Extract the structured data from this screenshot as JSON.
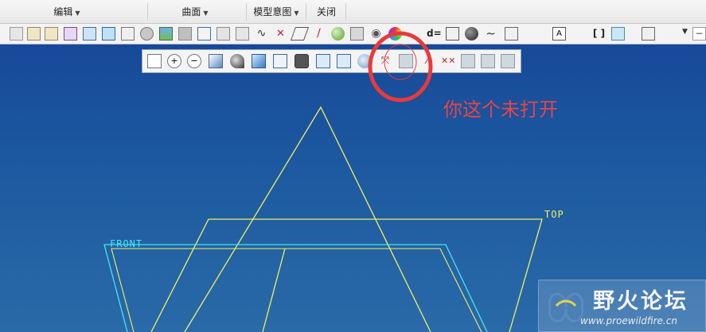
{
  "menubar": {
    "items": [
      {
        "label": "编辑"
      },
      {
        "label": "曲面"
      },
      {
        "label": "模型意图"
      },
      {
        "label": "关闭"
      }
    ]
  },
  "toolbar": {
    "icons": [
      "copy-icon",
      "paste-icon",
      "paste-special-icon",
      "frame-icon",
      "book-icon",
      "cube-flip-icon",
      "layer-tree-icon",
      "analysis-icon",
      "image-icon",
      "shade-icon",
      "surface-icon",
      "sketch-icon",
      "repaint-icon",
      "curve-icon",
      "datum-point-icon",
      "plane-icon",
      "axis-icon",
      "sphere-icon",
      "lock-icon",
      "hide-icon",
      "appearance-icon",
      "dimension-icon",
      "tolerance-icon",
      "sphere-dark-icon",
      "wave-icon",
      "box-icon",
      "annotation-icon",
      "bracket-icon",
      "bookmark-icon",
      "transform-icon",
      "more-icon"
    ]
  },
  "view_toolbar": {
    "icons": [
      "refit-icon",
      "zoom-in-icon",
      "zoom-out-icon",
      "repaint-icon",
      "display-style-icon",
      "saved-views-icon",
      "view-manager-icon",
      "perspective-icon",
      "spin-center-icon",
      "annotation-display-icon",
      "datum-axis-display-icon",
      "plane-display-icon",
      "point-display-icon",
      "csys-display-icon",
      "csys-tag-icon",
      "sketch-display-icon",
      "network-icon"
    ]
  },
  "annotation": {
    "text": "你这个未打开",
    "color": "#e84545"
  },
  "canvas": {
    "top_label": "TOP",
    "front_label": "FRONT",
    "colors": {
      "datum_yellow": "#f0f060",
      "datum_cyan": "#46e3f0"
    }
  },
  "watermark": {
    "title": "野火论坛",
    "url": "www.proewildfire.cn"
  }
}
